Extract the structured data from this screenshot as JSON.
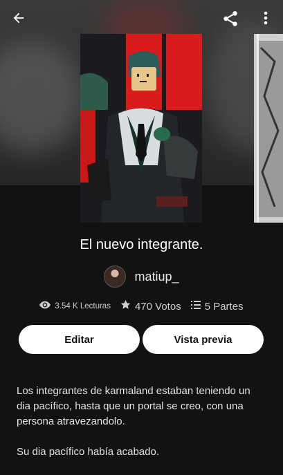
{
  "story": {
    "title": "El nuevo integrante.",
    "author": "matiup_",
    "stats": {
      "reads": "3.54 K Lecturas",
      "votes": "470 Votos",
      "parts": "5 Partes"
    },
    "description_paragraphs": [
      "Los integrantes de karmaland estaban teniendo un dia pacífico, hasta que un portal se creo, con una persona atravezandolo.",
      "Su dia pacífico había acabado."
    ]
  },
  "buttons": {
    "edit": "Editar",
    "preview": "Vista previa"
  },
  "icons": {
    "back": "back-arrow-icon",
    "share": "share-icon",
    "more": "more-vertical-icon",
    "reads": "eye-icon",
    "votes": "star-icon",
    "parts": "list-icon"
  },
  "colors": {
    "background": "#121212",
    "button_bg": "#ffffff",
    "button_text": "#111111",
    "cover_red": "#d81b1b"
  }
}
